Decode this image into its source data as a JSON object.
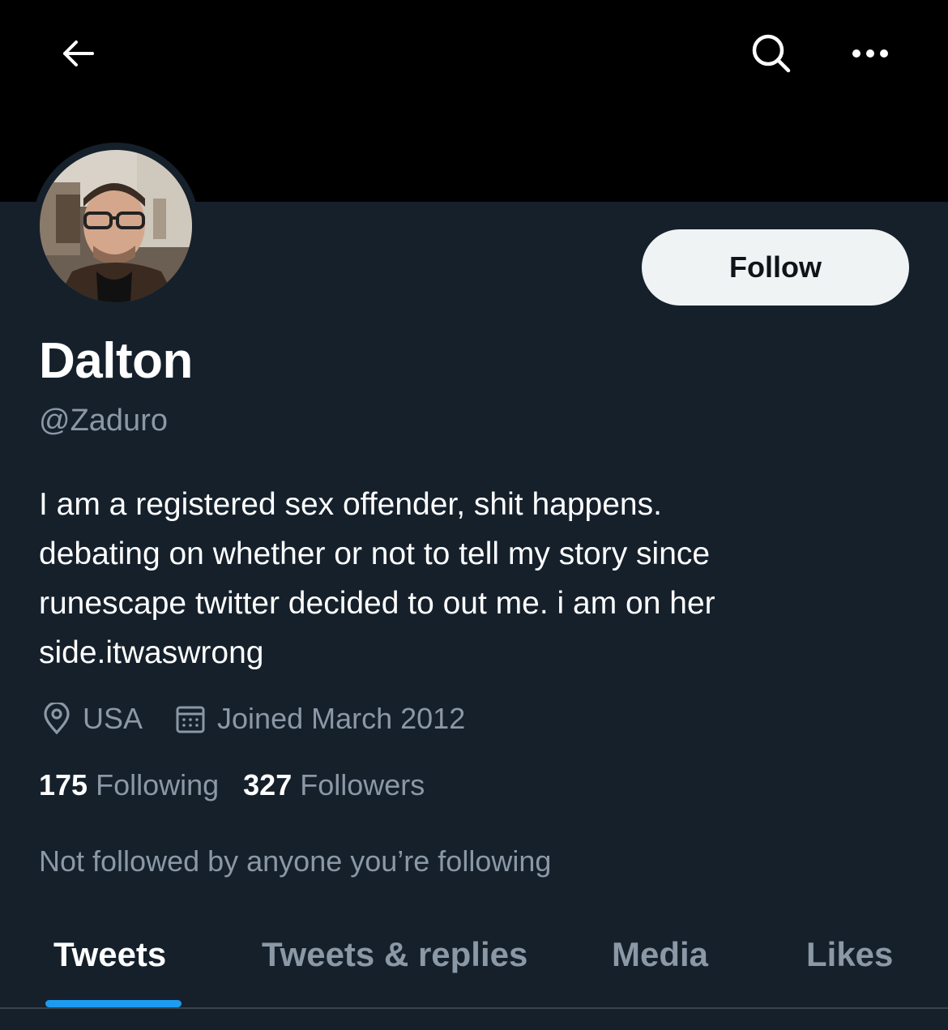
{
  "header": {
    "back_icon": "arrow-left-icon",
    "search_icon": "search-icon",
    "more_icon": "more-horizontal-icon"
  },
  "profile": {
    "display_name": "Dalton",
    "handle": "@Zaduro",
    "bio_lines": [
      "I am a registered sex offender, shit happens.",
      "debating on whether or not to tell my story since",
      "runescape twitter decided to out me. i am on her",
      "side.itwaswrong"
    ],
    "location": "USA",
    "joined": "Joined March 2012",
    "following_count": "175",
    "following_label": "Following",
    "followers_count": "327",
    "followers_label": "Followers",
    "not_followed_text": "Not followed by anyone you’re following"
  },
  "actions": {
    "follow_label": "Follow"
  },
  "tabs": [
    {
      "label": "Tweets",
      "active": true
    },
    {
      "label": "Tweets & replies",
      "active": false
    },
    {
      "label": "Media",
      "active": false
    },
    {
      "label": "Likes",
      "active": false
    }
  ],
  "colors": {
    "background": "#15202b",
    "banner": "#000000",
    "text_secondary": "#8b98a5",
    "accent": "#1d9bf0",
    "follow_button_bg": "#eff3f4"
  }
}
